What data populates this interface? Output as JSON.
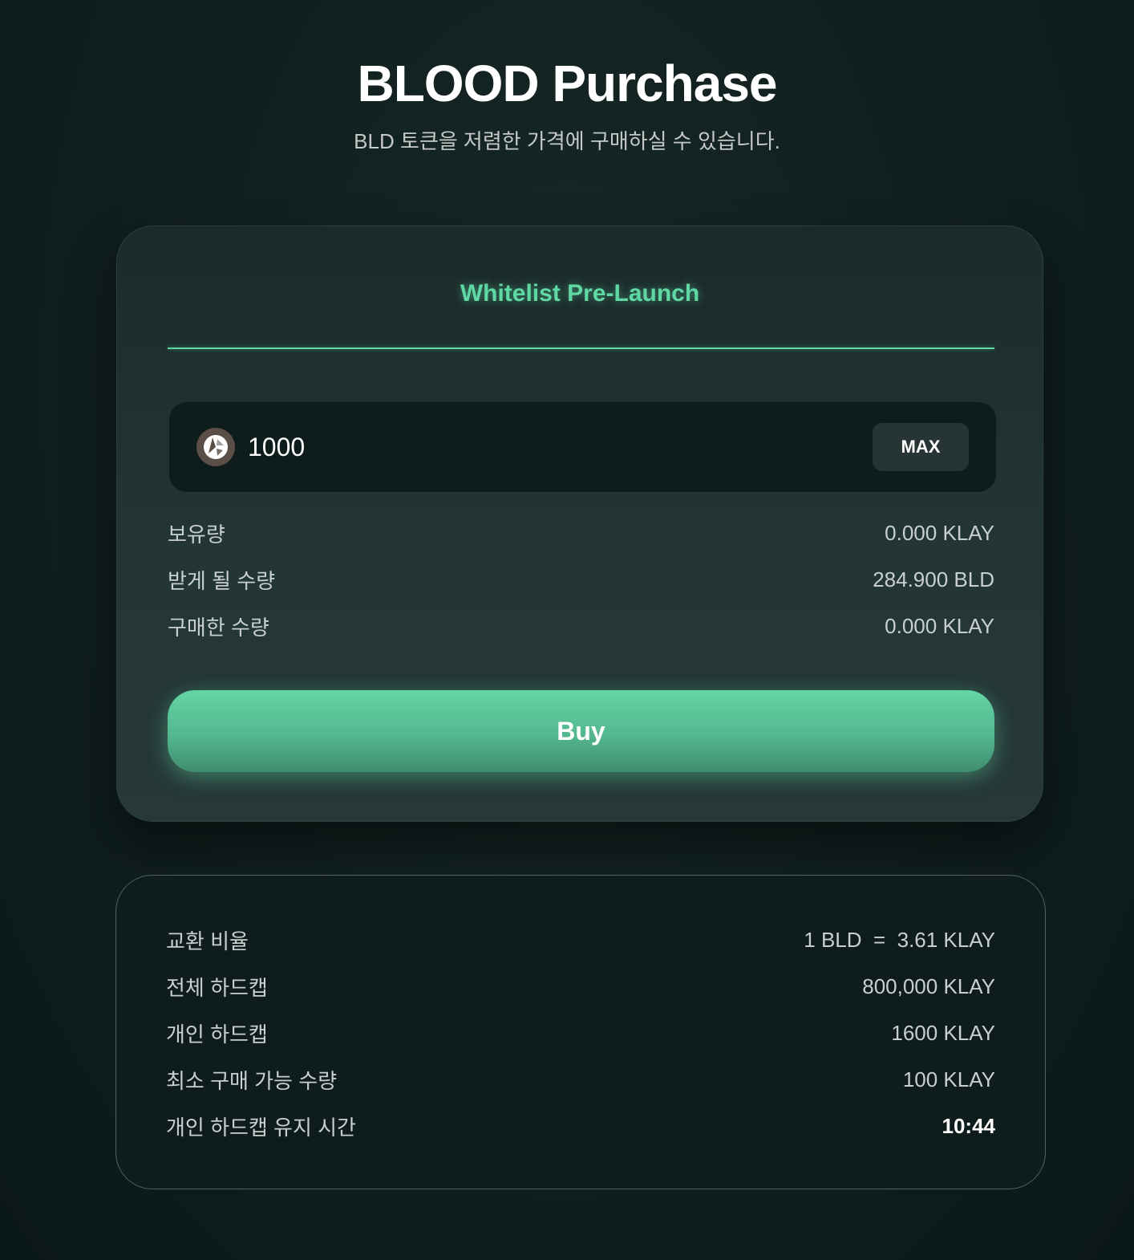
{
  "header": {
    "title": "BLOOD Purchase",
    "subtitle": "BLD 토큰을 저렴한 가격에 구매하실 수 있습니다."
  },
  "purchase_card": {
    "heading": "Whitelist Pre-Launch",
    "token_icon": "klay-token-icon",
    "amount_value": "1000",
    "max_label": "MAX",
    "rows": [
      {
        "label": "보유량",
        "value": "0.000 KLAY"
      },
      {
        "label": "받게 될 수량",
        "value": "284.900 BLD"
      },
      {
        "label": "구매한 수량",
        "value": "0.000 KLAY"
      }
    ],
    "buy_label": "Buy"
  },
  "details_card": {
    "rows": [
      {
        "label": "교환 비율",
        "value": "1 BLD  =  3.61 KLAY"
      },
      {
        "label": "전체 하드캡",
        "value": "800,000 KLAY"
      },
      {
        "label": "개인 하드캡",
        "value": "1600 KLAY"
      },
      {
        "label": "최소 구매 가능 수량",
        "value": "100 KLAY"
      },
      {
        "label": "개인 하드캡 유지 시간",
        "value": "10:44"
      }
    ]
  },
  "colors": {
    "accent": "#5fd8a4",
    "background": "#11201f",
    "card": "#233534"
  }
}
